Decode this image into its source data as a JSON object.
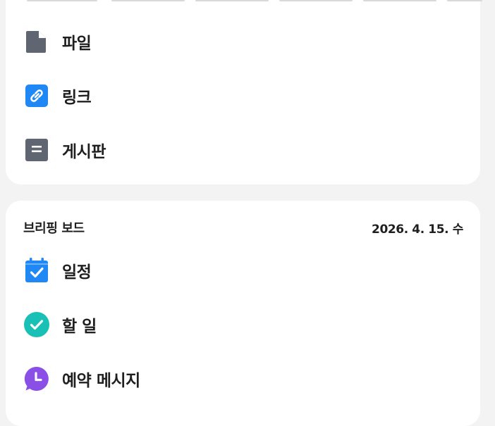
{
  "menu": {
    "items": [
      {
        "label": "파일",
        "icon": "file-icon"
      },
      {
        "label": "링크",
        "icon": "link-icon"
      },
      {
        "label": "게시판",
        "icon": "board-icon"
      }
    ]
  },
  "briefing": {
    "title": "브리핑 보드",
    "date": "2026. 4. 15. 수",
    "items": [
      {
        "label": "일정",
        "icon": "calendar-icon"
      },
      {
        "label": "할 일",
        "icon": "todo-check-icon"
      },
      {
        "label": "예약 메시지",
        "icon": "scheduled-message-icon"
      }
    ]
  },
  "colors": {
    "gray_icon": "#5f6672",
    "blue": "#1f88f5",
    "teal": "#18c0b5",
    "purple": "#8a4fe6",
    "background": "#f3f3f3",
    "card": "#ffffff"
  }
}
